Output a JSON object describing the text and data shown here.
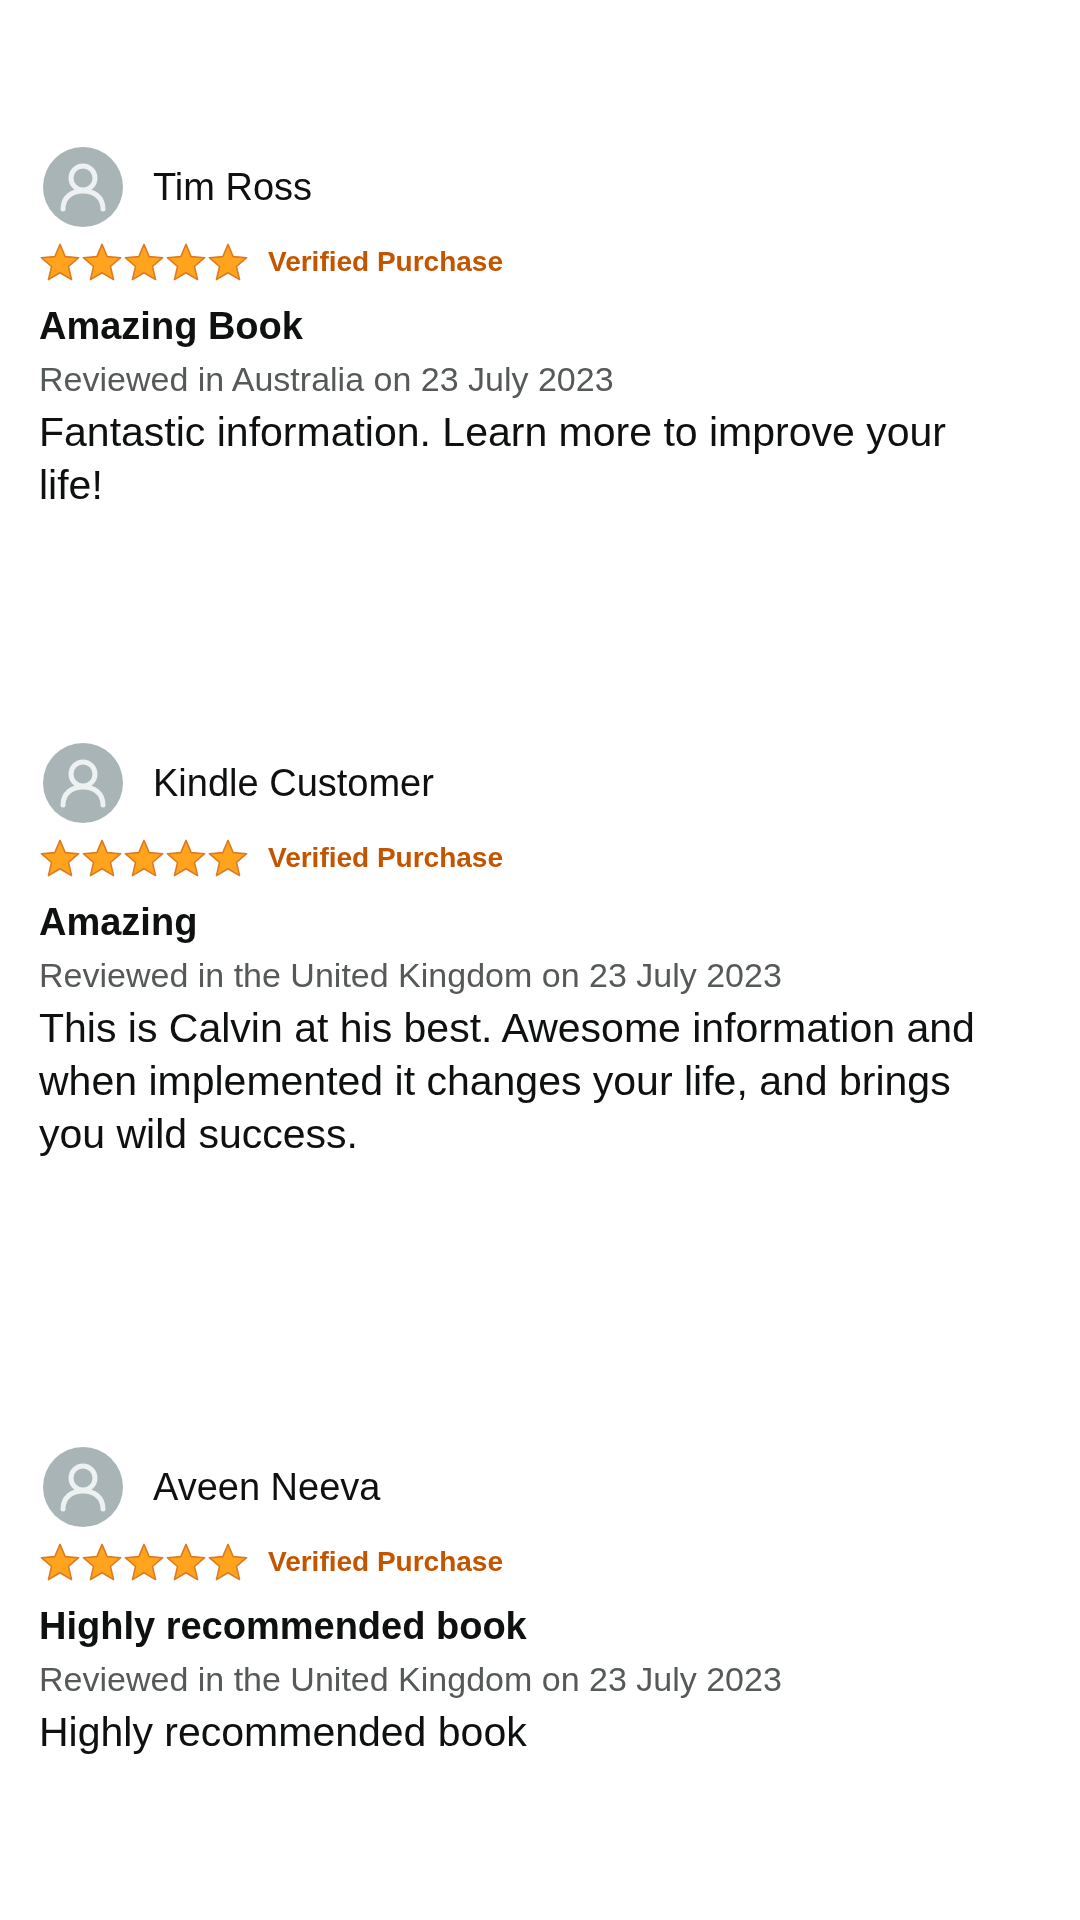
{
  "reviews": [
    {
      "reviewer": "Tim Ross",
      "stars": 5,
      "badge": "Verified Purchase",
      "title": "Amazing Book",
      "meta": "Reviewed in Australia on 23 July 2023",
      "body": "Fantastic information. Learn more to improve your life!"
    },
    {
      "reviewer": "Kindle Customer",
      "stars": 5,
      "badge": "Verified Purchase",
      "title": "Amazing",
      "meta": "Reviewed in the United Kingdom on 23 July 2023",
      "body": "This is Calvin at his best. Awesome information and when implemented it changes your life, and brings you wild success."
    },
    {
      "reviewer": "Aveen Neeva",
      "stars": 5,
      "badge": "Verified Purchase",
      "title": "Highly recommended book",
      "meta": "Reviewed in the United Kingdom on 23 July 2023",
      "body": "Highly recommended book"
    }
  ]
}
